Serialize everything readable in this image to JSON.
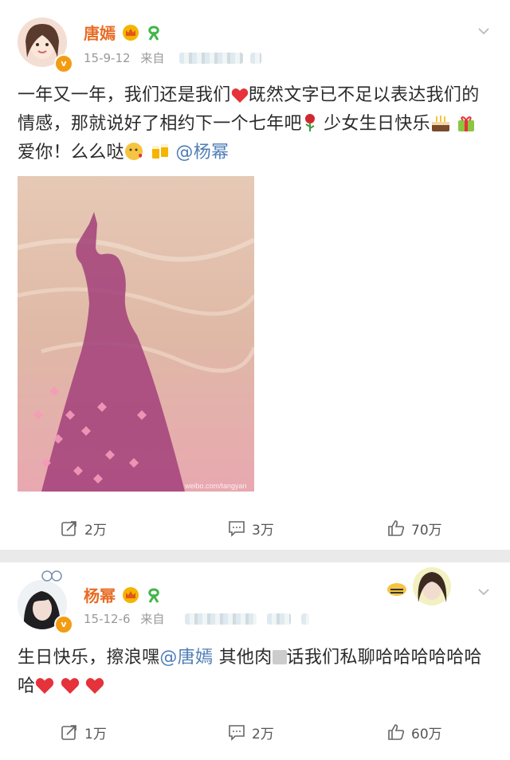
{
  "posts": [
    {
      "author": "唐嫣",
      "date": "15-9-12",
      "source_prefix": "来自",
      "text_parts": [
        "一年又一年，我们还是我们",
        "既然文字已不足以表达我们的情感，那就说好了相约下一个七年吧",
        "少女生日快乐",
        "爱你！么么哒",
        "@杨幂"
      ],
      "image_watermark": "weibo.com/tangyan",
      "actions": {
        "repost": "2万",
        "comment": "3万",
        "like": "70万"
      }
    },
    {
      "author": "杨幂",
      "date": "15-12-6",
      "source_prefix": "来自",
      "text_parts": [
        "生日快乐，擦浪嘿",
        "@唐嫣",
        " 其他肉",
        "话我们私聊哈哈哈哈哈哈哈"
      ],
      "actions": {
        "repost": "1万",
        "comment": "2万",
        "like": "60万"
      }
    }
  ],
  "colors": {
    "name": "#e86b24",
    "mention": "#4f7db6",
    "vip_badge": "#f39c12",
    "separator": "#eaeaea"
  },
  "icons": [
    "crown-icon",
    "ribbon-icon",
    "chevron-down-icon",
    "heart-icon",
    "rose-icon",
    "cake-icon",
    "gift-icon",
    "kiss-emoji-icon",
    "cheers-icon",
    "repost-icon",
    "comment-icon",
    "like-icon"
  ]
}
